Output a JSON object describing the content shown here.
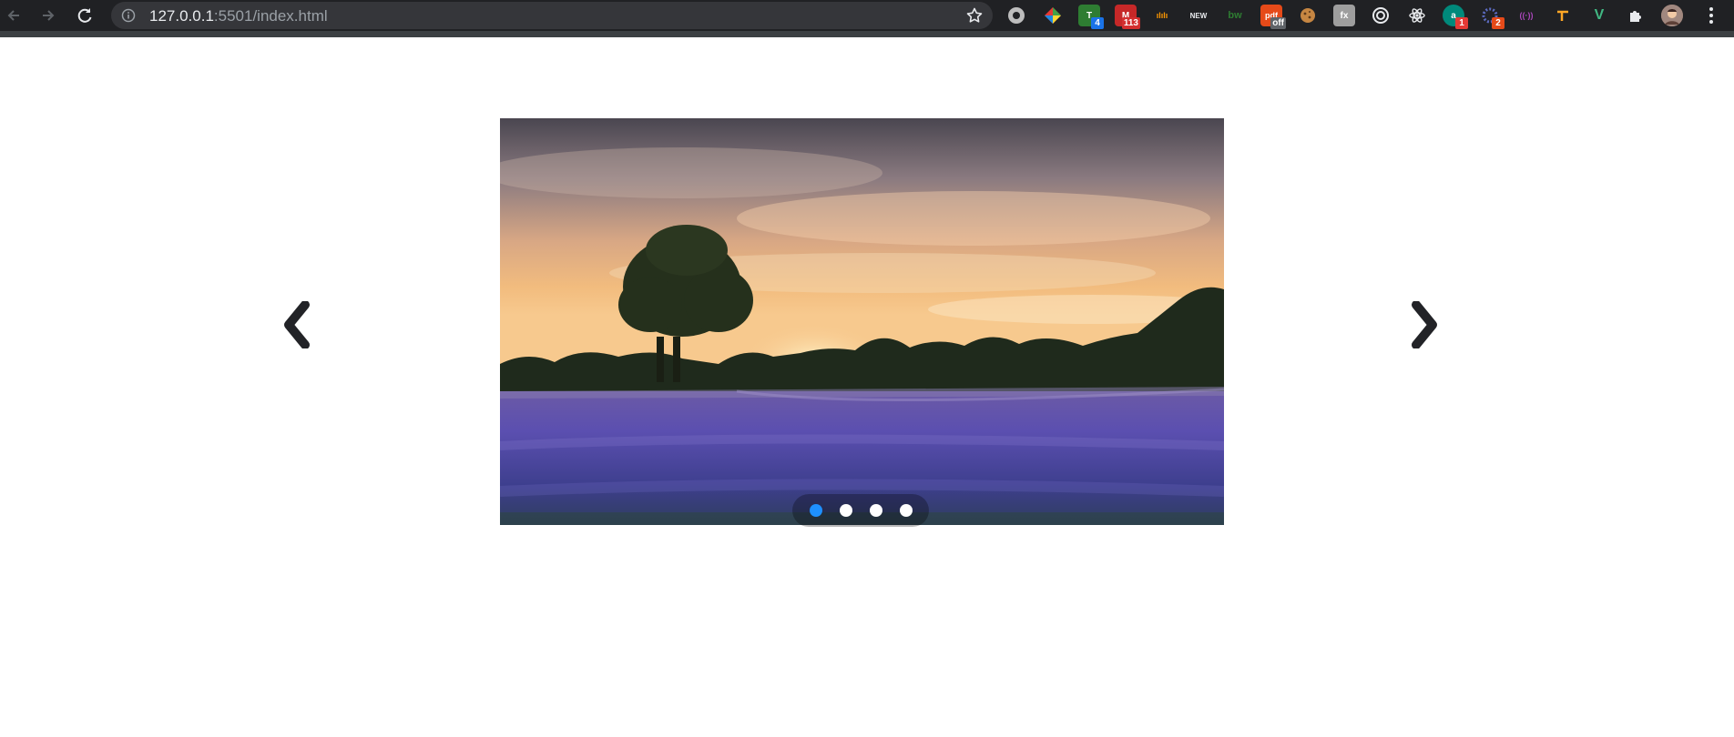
{
  "browser": {
    "url_host": "127.0.0.1",
    "url_rest": ":5501/index.html",
    "extensions": [
      {
        "name": "ext-1",
        "label": "",
        "badge": ""
      },
      {
        "name": "ext-2",
        "label": "",
        "badge": ""
      },
      {
        "name": "ext-3",
        "label": "T",
        "badge": "4"
      },
      {
        "name": "ext-4",
        "label": "M",
        "badge": "113"
      },
      {
        "name": "ext-5",
        "label": "ılılı",
        "badge": ""
      },
      {
        "name": "ext-6",
        "label": "NEW",
        "badge": ""
      },
      {
        "name": "ext-7",
        "label": "bw",
        "badge": ""
      },
      {
        "name": "ext-8",
        "label": "pdf",
        "badge": "off"
      },
      {
        "name": "ext-9",
        "label": "",
        "badge": ""
      },
      {
        "name": "ext-10",
        "label": "fx",
        "badge": ""
      },
      {
        "name": "ext-11",
        "label": "",
        "badge": ""
      },
      {
        "name": "ext-12",
        "label": "",
        "badge": ""
      },
      {
        "name": "ext-13",
        "label": "a",
        "badge": "1"
      },
      {
        "name": "ext-14",
        "label": "",
        "badge": "2"
      },
      {
        "name": "ext-15",
        "label": "((·))",
        "badge": ""
      },
      {
        "name": "ext-16",
        "label": "",
        "badge": ""
      },
      {
        "name": "ext-17",
        "label": "V",
        "badge": ""
      },
      {
        "name": "ext-18",
        "label": "",
        "badge": ""
      }
    ]
  },
  "carousel": {
    "prev_icon": "chevron-left-icon",
    "next_icon": "chevron-right-icon",
    "slide_count": 4,
    "active_index": 0,
    "active_dot_color": "#1e90ff",
    "inactive_dot_color": "#ffffff",
    "image_subject": "lavender-field-sunset"
  }
}
